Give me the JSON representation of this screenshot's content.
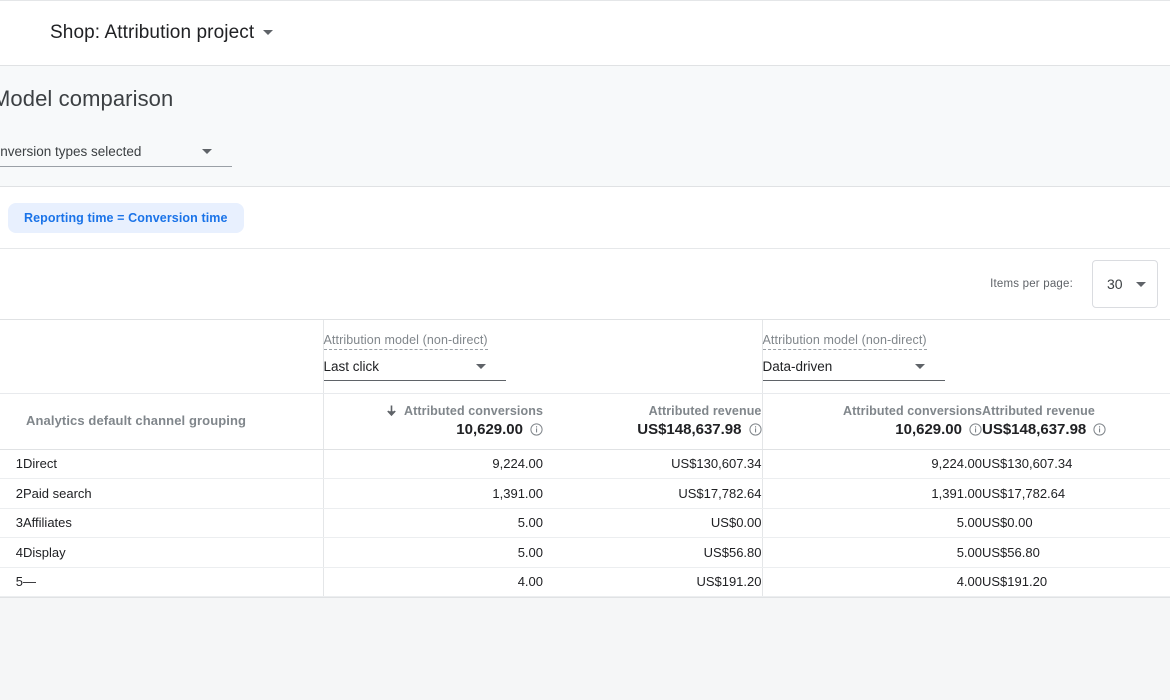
{
  "topbar": {
    "title": "Shop: Attribution project",
    "caret_icon": "chevron-down-icon"
  },
  "controls": {
    "page_heading": "Model comparison",
    "conversion_select": {
      "value": "conversion types selected",
      "caret_icon": "chevron-down-icon"
    }
  },
  "chips": [
    {
      "label": "Reporting time = Conversion time"
    }
  ],
  "pager": {
    "label": "Items per page:",
    "value": "30",
    "caret_icon": "chevron-down-icon"
  },
  "table": {
    "dimension_header": "Analytics default channel grouping",
    "model_groups": [
      {
        "dimension_label": "Attribution model (non-direct)",
        "model_value": "Last click",
        "caret_icon": "chevron-down-icon",
        "metrics": [
          {
            "name": "Attributed conversions",
            "total": "10,629.00",
            "sorted": true,
            "sort_icon": "arrow-down-icon",
            "info_icon": "info-icon"
          },
          {
            "name": "Attributed revenue",
            "total": "US$148,637.98",
            "sorted": false,
            "info_icon": "info-icon"
          }
        ]
      },
      {
        "dimension_label": "Attribution model (non-direct)",
        "model_value": "Data-driven",
        "caret_icon": "chevron-down-icon",
        "metrics": [
          {
            "name": "Attributed conversions",
            "total": "10,629.00",
            "sorted": false,
            "info_icon": "info-icon"
          },
          {
            "name": "Attributed revenue",
            "total": "US$148,637.98",
            "sorted": false,
            "info_icon": "info-icon"
          }
        ]
      }
    ],
    "rows": [
      {
        "index": "1",
        "channel": "Direct",
        "last_click_conversions": "9,224.00",
        "last_click_revenue": "US$130,607.34",
        "data_driven_conversions": "9,224.00",
        "data_driven_revenue": "US$130,607.34"
      },
      {
        "index": "2",
        "channel": "Paid search",
        "last_click_conversions": "1,391.00",
        "last_click_revenue": "US$17,782.64",
        "data_driven_conversions": "1,391.00",
        "data_driven_revenue": "US$17,782.64"
      },
      {
        "index": "3",
        "channel": "Affiliates",
        "last_click_conversions": "5.00",
        "last_click_revenue": "US$0.00",
        "data_driven_conversions": "5.00",
        "data_driven_revenue": "US$0.00"
      },
      {
        "index": "4",
        "channel": "Display",
        "last_click_conversions": "5.00",
        "last_click_revenue": "US$56.80",
        "data_driven_conversions": "5.00",
        "data_driven_revenue": "US$56.80"
      },
      {
        "index": "5",
        "channel": "—",
        "last_click_conversions": "4.00",
        "last_click_revenue": "US$191.20",
        "data_driven_conversions": "4.00",
        "data_driven_revenue": "US$191.20"
      }
    ]
  },
  "colors": {
    "chip_bg": "#e8f0fe",
    "chip_text": "#1a73e8",
    "page_bg": "#f5f6f7",
    "band_bg": "#f7f9fa",
    "text_primary": "#202124",
    "text_secondary": "#80868b"
  }
}
